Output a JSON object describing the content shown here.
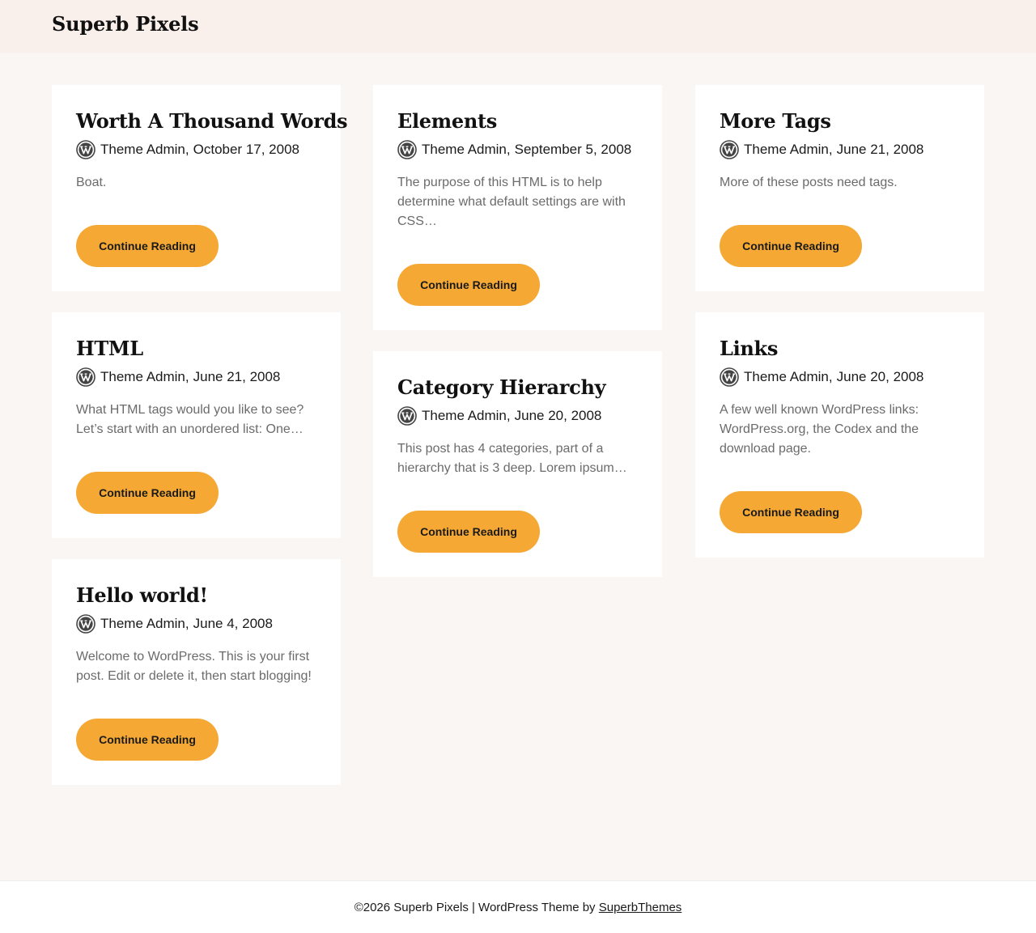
{
  "site": {
    "title": "Superb Pixels"
  },
  "colors": {
    "background": "#faf6f3",
    "header_bg": "#faf0eb",
    "accent": "#f5a833",
    "card_bg": "#ffffff"
  },
  "icons": {
    "author_avatar": "wordpress-logo-icon"
  },
  "columns": [
    [
      {
        "title": "Worth A Thousand Words",
        "author": "Theme Admin",
        "date": "October 17, 2008",
        "excerpt": "Boat.",
        "cta": "Continue Reading"
      },
      {
        "title": "HTML",
        "author": "Theme Admin",
        "date": "June 21, 2008",
        "excerpt": "What HTML tags would you like to see? Let’s start with an unordered list: One…",
        "cta": "Continue Reading"
      },
      {
        "title": "Hello world!",
        "author": "Theme Admin",
        "date": "June 4, 2008",
        "excerpt": "Welcome to WordPress. This is your first post. Edit or delete it, then start blogging!",
        "cta": "Continue Reading"
      }
    ],
    [
      {
        "title": "Elements",
        "author": "Theme Admin",
        "date": "September 5, 2008",
        "excerpt": "The purpose of this HTML is to help determine what default settings are with CSS…",
        "cta": "Continue Reading"
      },
      {
        "title": "Category Hierarchy",
        "author": "Theme Admin",
        "date": "June 20, 2008",
        "excerpt": "This post has 4 categories, part of a hierarchy that is 3 deep. Lorem ipsum…",
        "cta": "Continue Reading"
      }
    ],
    [
      {
        "title": "More Tags",
        "author": "Theme Admin",
        "date": "June 21, 2008",
        "excerpt": "More of these posts need tags.",
        "cta": "Continue Reading"
      },
      {
        "title": "Links",
        "author": "Theme Admin",
        "date": "June 20, 2008",
        "excerpt": "A few well known WordPress links: WordPress.org, the Codex and the download page.",
        "cta": "Continue Reading"
      }
    ]
  ],
  "footer": {
    "copyright": "©2026 Superb Pixels | WordPress Theme by ",
    "credit_link": "SuperbThemes"
  }
}
